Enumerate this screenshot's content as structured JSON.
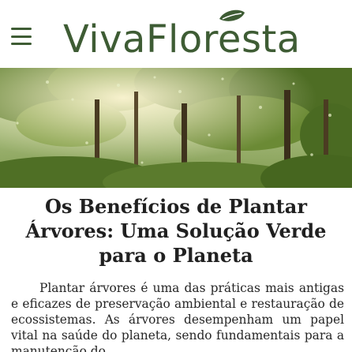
{
  "header": {
    "menu_icon": "hamburger-menu-icon",
    "logo_text": "VivaFloresta",
    "logo_icon": "leaf-icon",
    "accent_color": "#3e5c34"
  },
  "hero": {
    "image_subject": "forest-canopy-photo"
  },
  "article": {
    "title": "Os Benefícios de Plantar Árvores: Uma Solução Verde para o Planeta",
    "body": "Plantar árvores é uma das práticas mais antigas e eficazes de preservação ambiental e restauração de ecossistemas. As árvores desempenham um papel vital na saúde do planeta, sendo fundamentais para a manutenção do"
  }
}
